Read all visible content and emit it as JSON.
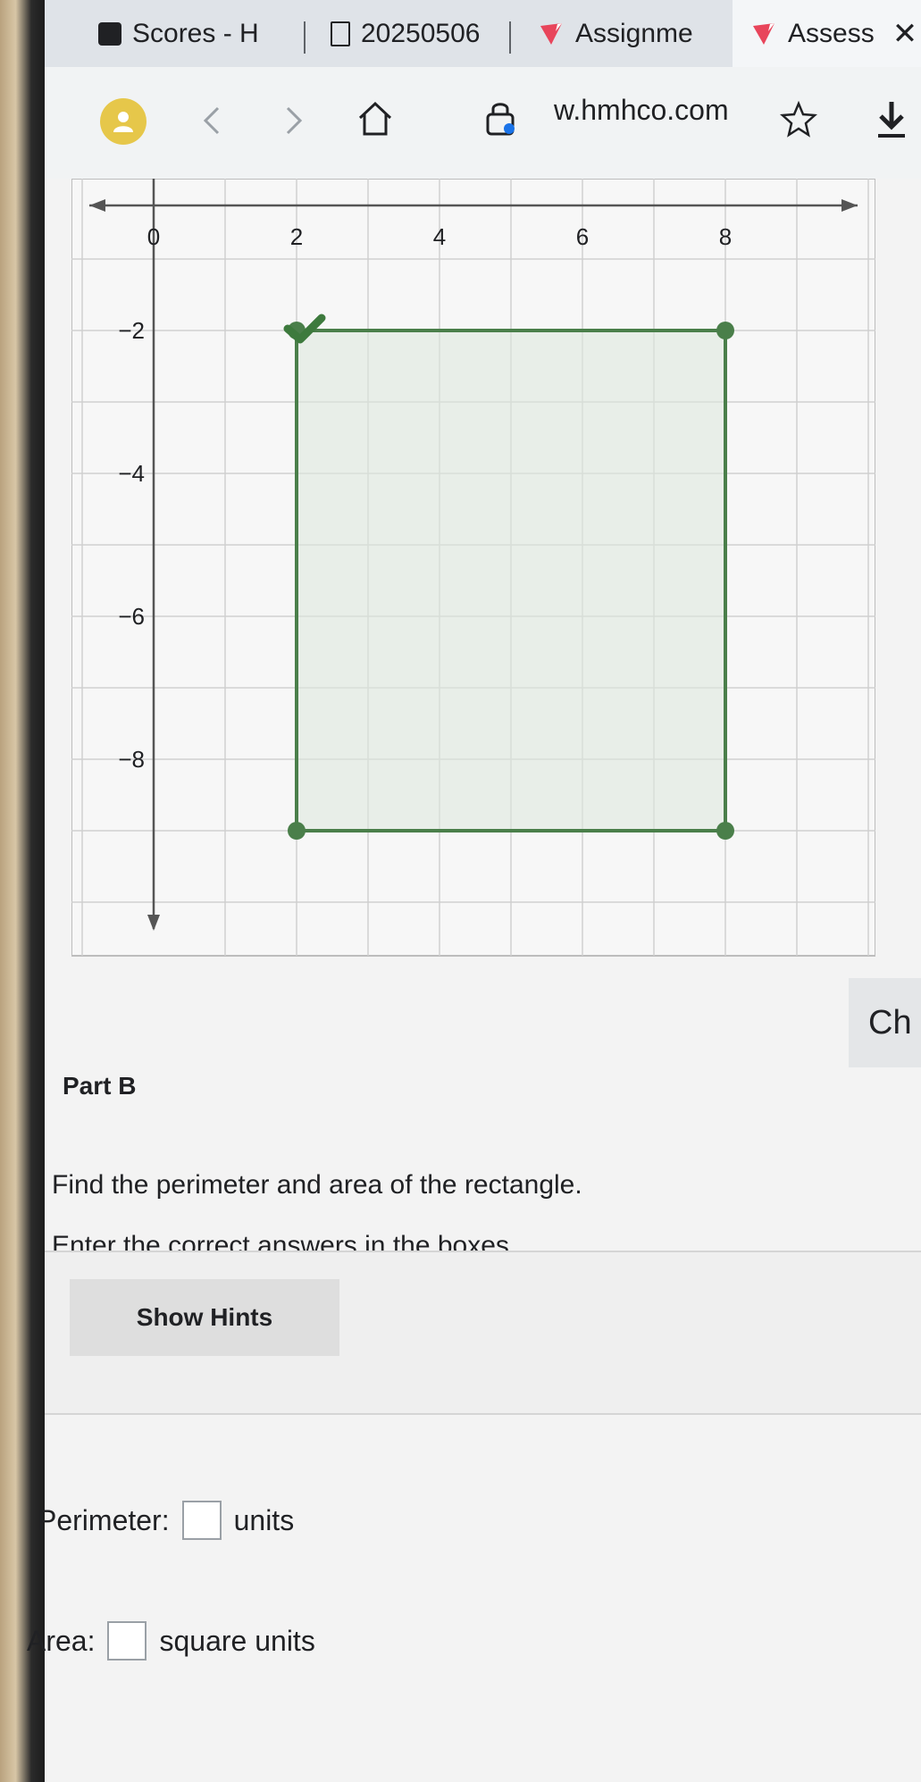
{
  "browser": {
    "tabs": [
      {
        "label": "Scores - H",
        "icon": "favicon-square-icon"
      },
      {
        "label": "20250506",
        "icon": "document-icon"
      },
      {
        "label": "Assignme",
        "icon": "hmh-logo-icon"
      },
      {
        "label": "Assess",
        "icon": "hmh-logo-icon",
        "active": true
      }
    ],
    "url": "w.hmhco.com"
  },
  "graph": {
    "x_ticks": [
      "0",
      "2",
      "4",
      "6",
      "8"
    ],
    "y_ticks": [
      "−2",
      "−4",
      "−6",
      "−8"
    ],
    "rectangle": {
      "x_min": 2,
      "x_max": 8,
      "y_min": -9,
      "y_max": -2
    },
    "x_range": [
      -1,
      10
    ],
    "y_range": [
      -10,
      0
    ],
    "fill_color": "#dde8dd",
    "stroke_color": "#4a7f4a",
    "correct_icon": "checkmark-icon"
  },
  "side_tab": {
    "label": "Ch"
  },
  "question": {
    "part": "Part B",
    "prompt": "Find the perimeter and area of the rectangle.",
    "instruction": "Enter the correct answers in the boxes.",
    "hint_button": "Show Hints"
  },
  "answers": {
    "perimeter_label": "Perimeter:",
    "perimeter_unit": "units",
    "area_label": "Area:",
    "area_unit": "square units"
  }
}
